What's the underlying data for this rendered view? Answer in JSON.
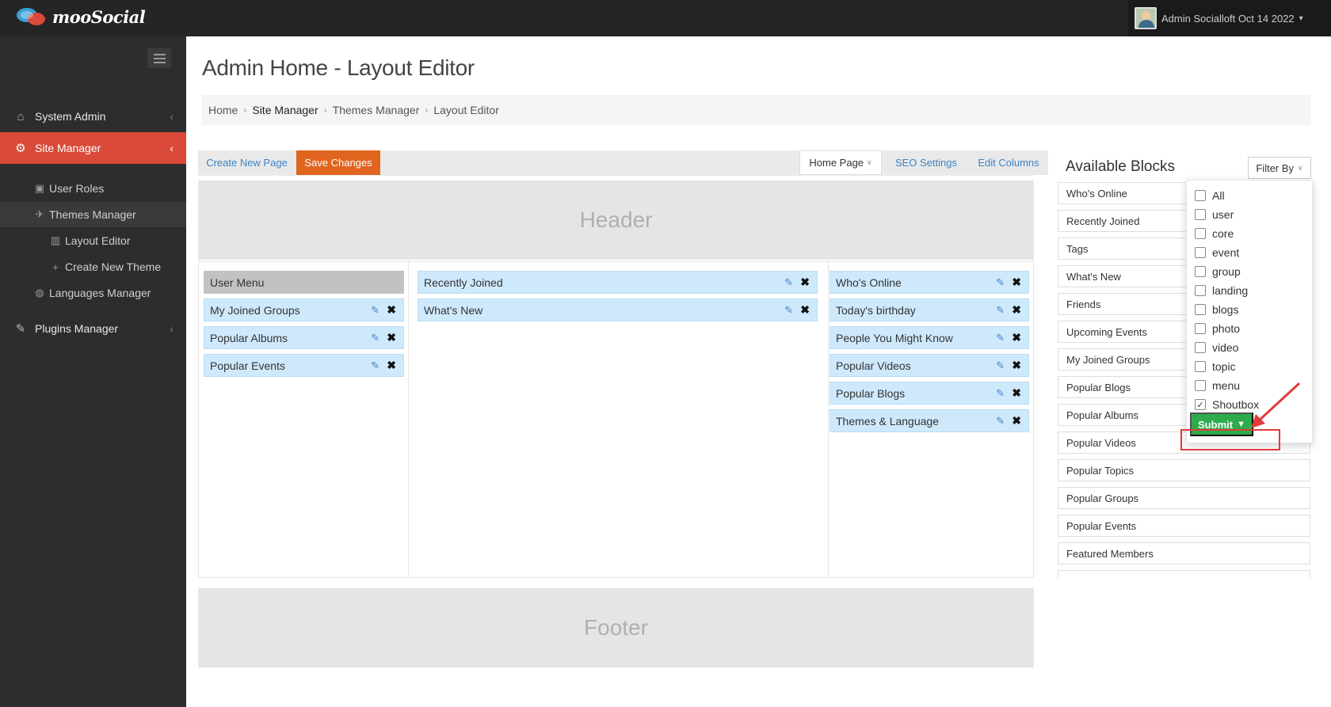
{
  "app": {
    "logo_text": "mooSocial",
    "user_name": "Admin Socialloft Oct 14 2022"
  },
  "sidebar": {
    "items": [
      {
        "label": "System Admin"
      },
      {
        "label": "Site Manager"
      },
      {
        "label": "Plugins Manager"
      }
    ],
    "sub_items": [
      {
        "label": "User Roles"
      },
      {
        "label": "Themes Manager"
      },
      {
        "label": "Layout Editor"
      },
      {
        "label": "Create New Theme"
      },
      {
        "label": "Languages Manager"
      }
    ]
  },
  "page": {
    "title": "Admin Home - Layout Editor",
    "breadcrumb": [
      "Home",
      "Site Manager",
      "Themes Manager",
      "Layout Editor"
    ]
  },
  "toolbar": {
    "create_page": "Create New Page",
    "save_changes": "Save Changes",
    "page_select": "Home Page",
    "seo_settings": "SEO Settings",
    "edit_columns": "Edit Columns"
  },
  "layout": {
    "header": "Header",
    "footer": "Footer",
    "left_column": [
      "User Menu",
      "My Joined Groups",
      "Popular Albums",
      "Popular Events"
    ],
    "center_column": [
      "Recently Joined",
      "What's New"
    ],
    "right_column": [
      "Who's Online",
      "Today's birthday",
      "People You Might Know",
      "Popular Videos",
      "Popular Blogs",
      "Themes & Language"
    ]
  },
  "available_blocks": {
    "title": "Available Blocks",
    "filter_label": "Filter By",
    "items": [
      "Who's Online",
      "Recently Joined",
      "Tags",
      "What's New",
      "Friends",
      "Upcoming Events",
      "My Joined Groups",
      "Popular Blogs",
      "Popular Albums",
      "Popular Videos",
      "Popular Topics",
      "Popular Groups",
      "Popular Events",
      "Featured Members"
    ]
  },
  "filter_dropdown": {
    "options": [
      {
        "label": "All",
        "checked": false
      },
      {
        "label": "user",
        "checked": false
      },
      {
        "label": "core",
        "checked": false
      },
      {
        "label": "event",
        "checked": false
      },
      {
        "label": "group",
        "checked": false
      },
      {
        "label": "landing",
        "checked": false
      },
      {
        "label": "blogs",
        "checked": false
      },
      {
        "label": "photo",
        "checked": false
      },
      {
        "label": "video",
        "checked": false
      },
      {
        "label": "topic",
        "checked": false
      },
      {
        "label": "menu",
        "checked": false
      },
      {
        "label": "Shoutbox",
        "checked": true
      }
    ],
    "submit_label": "Submit"
  },
  "colors": {
    "accent": "#d94a38",
    "save": "#e0651f",
    "submit": "#2eab4d",
    "block": "#cfe9fc",
    "highlight": "#e23b3b"
  }
}
